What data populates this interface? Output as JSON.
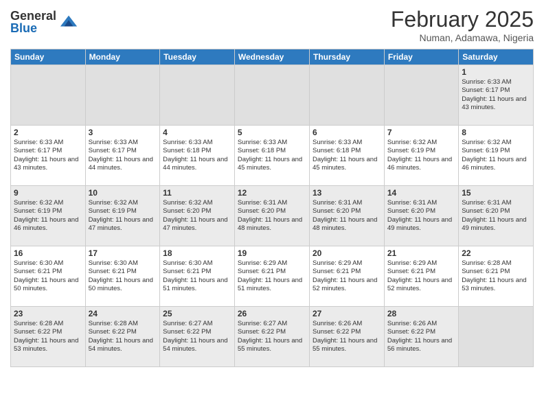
{
  "header": {
    "logo_general": "General",
    "logo_blue": "Blue",
    "month_year": "February 2025",
    "location": "Numan, Adamawa, Nigeria"
  },
  "days_of_week": [
    "Sunday",
    "Monday",
    "Tuesday",
    "Wednesday",
    "Thursday",
    "Friday",
    "Saturday"
  ],
  "weeks": [
    [
      {
        "day": "",
        "info": "",
        "empty": true
      },
      {
        "day": "",
        "info": "",
        "empty": true
      },
      {
        "day": "",
        "info": "",
        "empty": true
      },
      {
        "day": "",
        "info": "",
        "empty": true
      },
      {
        "day": "",
        "info": "",
        "empty": true
      },
      {
        "day": "",
        "info": "",
        "empty": true
      },
      {
        "day": "1",
        "info": "Sunrise: 6:33 AM\nSunset: 6:17 PM\nDaylight: 11 hours\nand 43 minutes."
      }
    ],
    [
      {
        "day": "2",
        "info": "Sunrise: 6:33 AM\nSunset: 6:17 PM\nDaylight: 11 hours\nand 43 minutes."
      },
      {
        "day": "3",
        "info": "Sunrise: 6:33 AM\nSunset: 6:17 PM\nDaylight: 11 hours\nand 44 minutes."
      },
      {
        "day": "4",
        "info": "Sunrise: 6:33 AM\nSunset: 6:18 PM\nDaylight: 11 hours\nand 44 minutes."
      },
      {
        "day": "5",
        "info": "Sunrise: 6:33 AM\nSunset: 6:18 PM\nDaylight: 11 hours\nand 45 minutes."
      },
      {
        "day": "6",
        "info": "Sunrise: 6:33 AM\nSunset: 6:18 PM\nDaylight: 11 hours\nand 45 minutes."
      },
      {
        "day": "7",
        "info": "Sunrise: 6:32 AM\nSunset: 6:19 PM\nDaylight: 11 hours\nand 46 minutes."
      },
      {
        "day": "8",
        "info": "Sunrise: 6:32 AM\nSunset: 6:19 PM\nDaylight: 11 hours\nand 46 minutes."
      }
    ],
    [
      {
        "day": "9",
        "info": "Sunrise: 6:32 AM\nSunset: 6:19 PM\nDaylight: 11 hours\nand 46 minutes."
      },
      {
        "day": "10",
        "info": "Sunrise: 6:32 AM\nSunset: 6:19 PM\nDaylight: 11 hours\nand 47 minutes."
      },
      {
        "day": "11",
        "info": "Sunrise: 6:32 AM\nSunset: 6:20 PM\nDaylight: 11 hours\nand 47 minutes."
      },
      {
        "day": "12",
        "info": "Sunrise: 6:31 AM\nSunset: 6:20 PM\nDaylight: 11 hours\nand 48 minutes."
      },
      {
        "day": "13",
        "info": "Sunrise: 6:31 AM\nSunset: 6:20 PM\nDaylight: 11 hours\nand 48 minutes."
      },
      {
        "day": "14",
        "info": "Sunrise: 6:31 AM\nSunset: 6:20 PM\nDaylight: 11 hours\nand 49 minutes."
      },
      {
        "day": "15",
        "info": "Sunrise: 6:31 AM\nSunset: 6:20 PM\nDaylight: 11 hours\nand 49 minutes."
      }
    ],
    [
      {
        "day": "16",
        "info": "Sunrise: 6:30 AM\nSunset: 6:21 PM\nDaylight: 11 hours\nand 50 minutes."
      },
      {
        "day": "17",
        "info": "Sunrise: 6:30 AM\nSunset: 6:21 PM\nDaylight: 11 hours\nand 50 minutes."
      },
      {
        "day": "18",
        "info": "Sunrise: 6:30 AM\nSunset: 6:21 PM\nDaylight: 11 hours\nand 51 minutes."
      },
      {
        "day": "19",
        "info": "Sunrise: 6:29 AM\nSunset: 6:21 PM\nDaylight: 11 hours\nand 51 minutes."
      },
      {
        "day": "20",
        "info": "Sunrise: 6:29 AM\nSunset: 6:21 PM\nDaylight: 11 hours\nand 52 minutes."
      },
      {
        "day": "21",
        "info": "Sunrise: 6:29 AM\nSunset: 6:21 PM\nDaylight: 11 hours\nand 52 minutes."
      },
      {
        "day": "22",
        "info": "Sunrise: 6:28 AM\nSunset: 6:21 PM\nDaylight: 11 hours\nand 53 minutes."
      }
    ],
    [
      {
        "day": "23",
        "info": "Sunrise: 6:28 AM\nSunset: 6:22 PM\nDaylight: 11 hours\nand 53 minutes."
      },
      {
        "day": "24",
        "info": "Sunrise: 6:28 AM\nSunset: 6:22 PM\nDaylight: 11 hours\nand 54 minutes."
      },
      {
        "day": "25",
        "info": "Sunrise: 6:27 AM\nSunset: 6:22 PM\nDaylight: 11 hours\nand 54 minutes."
      },
      {
        "day": "26",
        "info": "Sunrise: 6:27 AM\nSunset: 6:22 PM\nDaylight: 11 hours\nand 55 minutes."
      },
      {
        "day": "27",
        "info": "Sunrise: 6:26 AM\nSunset: 6:22 PM\nDaylight: 11 hours\nand 55 minutes."
      },
      {
        "day": "28",
        "info": "Sunrise: 6:26 AM\nSunset: 6:22 PM\nDaylight: 11 hours\nand 56 minutes."
      },
      {
        "day": "",
        "info": "",
        "empty": true
      }
    ]
  ]
}
